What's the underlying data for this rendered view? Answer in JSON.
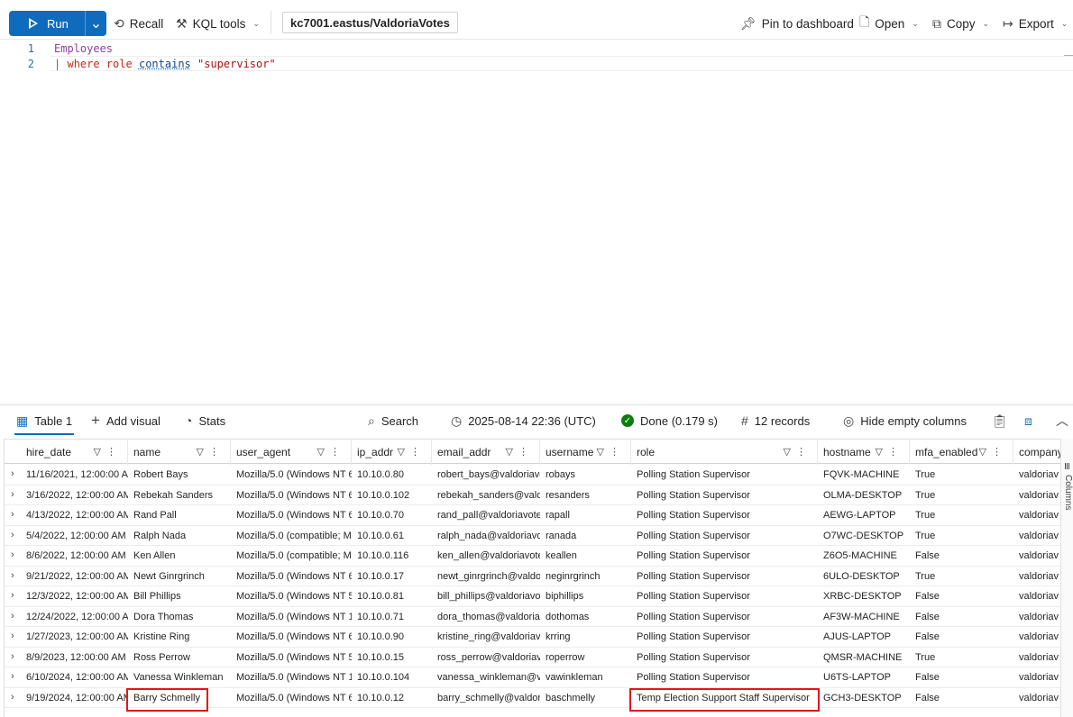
{
  "toolbar": {
    "run_label": "Run",
    "recall_label": "Recall",
    "kql_tools_label": "KQL tools",
    "database": "kc7001.eastus/ValdoriaVotes",
    "pin_label": "Pin to dashboard",
    "open_label": "Open",
    "copy_label": "Copy",
    "export_label": "Export"
  },
  "editor": {
    "lines": [
      {
        "number": "1",
        "table": "Employees"
      },
      {
        "number": "2",
        "pipe": "|",
        "op": "where",
        "field": "role",
        "operator": "contains",
        "value": "\"supervisor\""
      }
    ]
  },
  "results_bar": {
    "table_tab": "Table 1",
    "add_visual": "Add visual",
    "stats": "Stats",
    "search": "Search",
    "timestamp": "2025-08-14 22:36 (UTC)",
    "status": "Done (0.179 s)",
    "records": "12 records",
    "hide_empty": "Hide empty columns"
  },
  "side_panel": {
    "label": "Columns"
  },
  "table": {
    "columns": [
      "hire_date",
      "name",
      "user_agent",
      "ip_addr",
      "email_addr",
      "username",
      "role",
      "hostname",
      "mfa_enabled",
      "company"
    ],
    "rows": [
      [
        "11/16/2021, 12:00:00 AM",
        "Robert Bays",
        "Mozilla/5.0 (Windows NT 6",
        "10.10.0.80",
        "robert_bays@valdoriavo",
        "robays",
        "Polling Station Supervisor",
        "FQVK-MACHINE",
        "True",
        "valdoriav"
      ],
      [
        "3/16/2022, 12:00:00 AM",
        "Rebekah Sanders",
        "Mozilla/5.0 (Windows NT 6",
        "10.10.0.102",
        "rebekah_sanders@valdo",
        "resanders",
        "Polling Station Supervisor",
        "OLMA-DESKTOP",
        "True",
        "valdoriav"
      ],
      [
        "4/13/2022, 12:00:00 AM",
        "Rand Pall",
        "Mozilla/5.0 (Windows NT 6",
        "10.10.0.70",
        "rand_pall@valdoriavote",
        "rapall",
        "Polling Station Supervisor",
        "AEWG-LAPTOP",
        "True",
        "valdoriav"
      ],
      [
        "5/4/2022, 12:00:00 AM",
        "Ralph Nada",
        "Mozilla/5.0 (compatible; M",
        "10.10.0.61",
        "ralph_nada@valdoriavo",
        "ranada",
        "Polling Station Supervisor",
        "O7WC-DESKTOP",
        "True",
        "valdoriav"
      ],
      [
        "8/6/2022, 12:00:00 AM",
        "Ken Allen",
        "Mozilla/5.0 (compatible; M",
        "10.10.0.116",
        "ken_allen@valdoriavote",
        "keallen",
        "Polling Station Supervisor",
        "Z6O5-MACHINE",
        "False",
        "valdoriav"
      ],
      [
        "9/21/2022, 12:00:00 AM",
        "Newt Ginrgrinch",
        "Mozilla/5.0 (Windows NT 6",
        "10.10.0.17",
        "newt_ginrgrinch@valdo",
        "neginrgrinch",
        "Polling Station Supervisor",
        "6ULO-DESKTOP",
        "True",
        "valdoriav"
      ],
      [
        "12/3/2022, 12:00:00 AM",
        "Bill Phillips",
        "Mozilla/5.0 (Windows NT 5",
        "10.10.0.81",
        "bill_phillips@valdoriavo",
        "biphillips",
        "Polling Station Supervisor",
        "XRBC-DESKTOP",
        "False",
        "valdoriav"
      ],
      [
        "12/24/2022, 12:00:00 A",
        "Dora Thomas",
        "Mozilla/5.0 (Windows NT 1",
        "10.10.0.71",
        "dora_thomas@valdoriav",
        "dothomas",
        "Polling Station Supervisor",
        "AF3W-MACHINE",
        "False",
        "valdoriav"
      ],
      [
        "1/27/2023, 12:00:00 AM",
        "Kristine Ring",
        "Mozilla/5.0 (Windows NT 6",
        "10.10.0.90",
        "kristine_ring@valdoriav",
        "krring",
        "Polling Station Supervisor",
        "AJUS-LAPTOP",
        "False",
        "valdoriav"
      ],
      [
        "8/9/2023, 12:00:00 AM",
        "Ross Perrow",
        "Mozilla/5.0 (Windows NT 5",
        "10.10.0.15",
        "ross_perrow@valdoriave",
        "roperrow",
        "Polling Station Supervisor",
        "QMSR-MACHINE",
        "True",
        "valdoriav"
      ],
      [
        "6/10/2024, 12:00:00 AM",
        "Vanessa Winkleman",
        "Mozilla/5.0 (Windows NT 1",
        "10.10.0.104",
        "vanessa_winkleman@va",
        "vawinkleman",
        "Polling Station Supervisor",
        "U6TS-LAPTOP",
        "False",
        "valdoriav"
      ],
      [
        "9/19/2024, 12:00:00 AM",
        "Barry Schmelly",
        "Mozilla/5.0 (Windows NT 6",
        "10.10.0.12",
        "barry_schmelly@valdori",
        "baschmelly",
        "Temp Election Support Staff Supervisor",
        "GCH3-DESKTOP",
        "False",
        "valdoriav"
      ]
    ]
  },
  "colors": {
    "accent": "#0f6cbd",
    "highlight": "#e3151a",
    "success": "#107c10"
  }
}
